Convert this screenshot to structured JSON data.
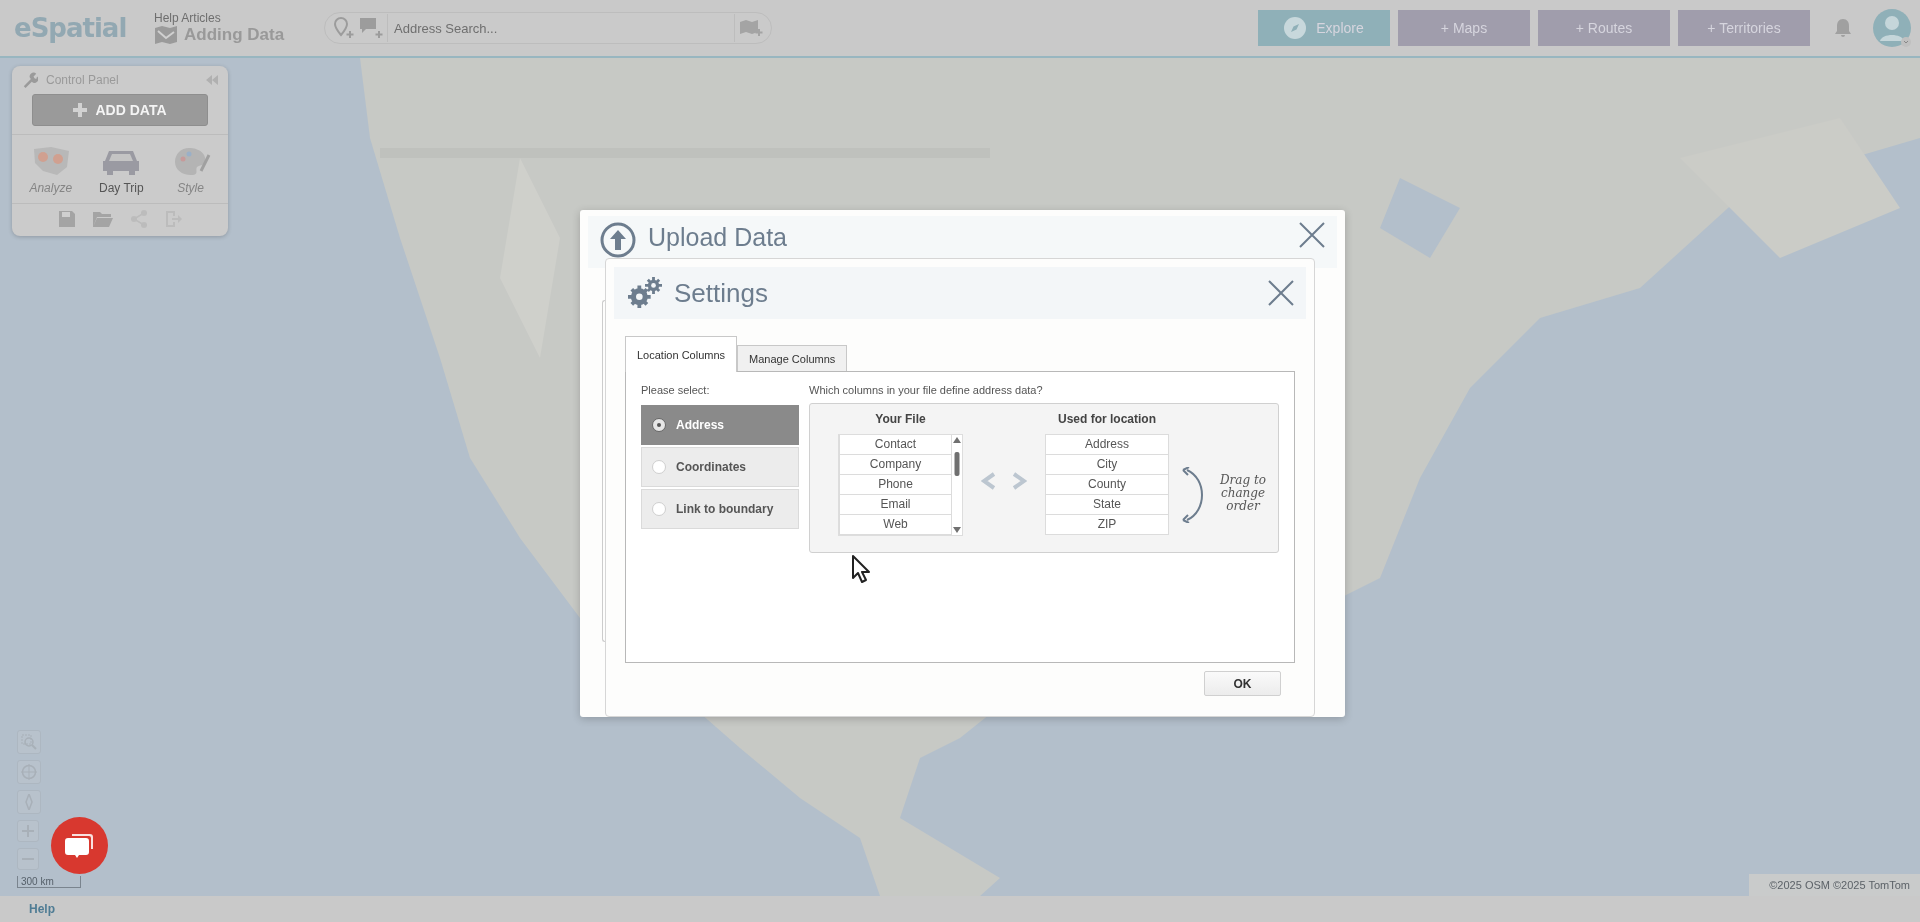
{
  "app": {
    "logo": "eSpatial",
    "breadcrumb": "Help Articles",
    "page_title": "Adding Data"
  },
  "search": {
    "placeholder": "Address Search..."
  },
  "nav_buttons": [
    {
      "label": "Explore",
      "selected": true
    },
    {
      "label": "+ Maps",
      "selected": false
    },
    {
      "label": "+ Routes",
      "selected": false
    },
    {
      "label": "+ Territories",
      "selected": false
    }
  ],
  "control_panel": {
    "title": "Control Panel",
    "add_button": "ADD DATA",
    "tools": [
      {
        "label": "Analyze",
        "disabled": true
      },
      {
        "label": "Day Trip",
        "disabled": false
      },
      {
        "label": "Style",
        "disabled": true
      }
    ]
  },
  "upload_dialog": {
    "title": "Upload Data"
  },
  "settings_dialog": {
    "title": "Settings",
    "tabs": [
      {
        "label": "Location Columns",
        "selected": true
      },
      {
        "label": "Manage Columns",
        "selected": false
      }
    ],
    "prompt": "Please select:",
    "options": [
      {
        "label": "Address",
        "selected": true
      },
      {
        "label": "Coordinates",
        "selected": false
      },
      {
        "label": "Link to boundary",
        "selected": false
      }
    ],
    "question": "Which columns in your file define address data?",
    "your_file": {
      "heading": "Your File",
      "items": [
        "Contact",
        "Company",
        "Phone",
        "Email",
        "Web"
      ]
    },
    "used_for_location": {
      "heading": "Used for location",
      "items": [
        "Address",
        "City",
        "County",
        "State",
        "ZIP"
      ]
    },
    "hint": "Drag to change order",
    "ok_button": "OK"
  },
  "map": {
    "scale": "300 km",
    "attribution": "©2025 OSM ©2025 TomTom"
  },
  "footer": {
    "help": "Help"
  }
}
